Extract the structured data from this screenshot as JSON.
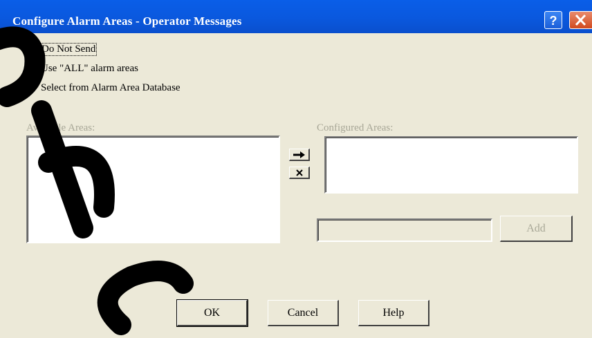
{
  "window": {
    "title": "Configure Alarm Areas - Operator Messages"
  },
  "titlebar_icons": {
    "help": "?",
    "close": "✕"
  },
  "options": {
    "do_not_send": "Do Not Send",
    "use_all": "Use \"ALL\" alarm areas",
    "select_db": "Select from Alarm Area Database",
    "selected": "do_not_send"
  },
  "available": {
    "label": "Available Areas:",
    "items": []
  },
  "configured": {
    "label": "Configured Areas:",
    "items": []
  },
  "transfer": {
    "add_icon": "→",
    "remove_icon": "x"
  },
  "new_area": {
    "value": "",
    "add_label": "Add"
  },
  "buttons": {
    "ok": "OK",
    "cancel": "Cancel",
    "help": "Help"
  }
}
